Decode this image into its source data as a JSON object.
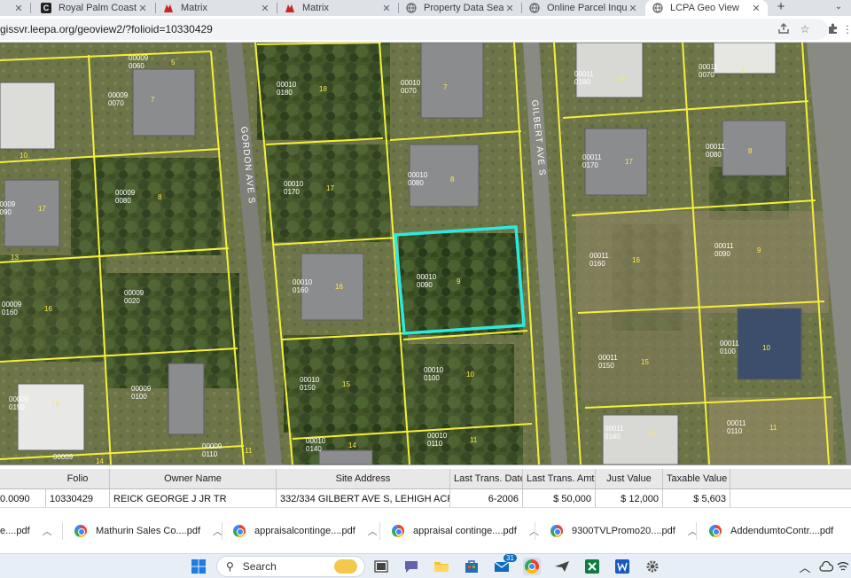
{
  "browser": {
    "tabs": [
      {
        "title": "",
        "icon": "partial-tab-icon"
      },
      {
        "title": "Royal Palm Coast REA",
        "icon": "c-logo-icon",
        "favicon_glyph": "C"
      },
      {
        "title": "Matrix",
        "icon": "matrix-logo-icon"
      },
      {
        "title": "Matrix",
        "icon": "matrix-logo-icon"
      },
      {
        "title": "Property Data Search",
        "icon": "globe-icon"
      },
      {
        "title": "Online Parcel Inquiry",
        "icon": "globe-icon"
      },
      {
        "title": "LCPA Geo View",
        "icon": "globe-icon",
        "active": true
      }
    ],
    "new_tab": "+",
    "url": "gissvr.leepa.org/geoview2/?folioid=10330429"
  },
  "map": {
    "streets": [
      "GORDON AVE S",
      "GILBERT AVE S"
    ],
    "selected_parcel": {
      "id1": "00010",
      "id2": "0090",
      "lot": "9"
    },
    "parcels": [
      {
        "a": "00009",
        "b": "0060",
        "lot": "5"
      },
      {
        "a": "00009",
        "b": "0070",
        "lot": "7"
      },
      {
        "a": "00009",
        "b": "0080",
        "lot": "8"
      },
      {
        "a": "00009",
        "b": "0090",
        "lot": "17"
      },
      {
        "a": "00009",
        "b": "0020",
        "lot": ""
      },
      {
        "a": "00009",
        "b": "0160",
        "lot": "16"
      },
      {
        "a": "00009",
        "b": "0100",
        "lot": ""
      },
      {
        "a": "00009",
        "b": "0150",
        "lot": "15"
      },
      {
        "a": "00009",
        "b": "0110",
        "lot": "11"
      },
      {
        "a": "00009",
        "b": "",
        "lot": "14"
      },
      {
        "a": "00010",
        "b": "0180",
        "lot": "18"
      },
      {
        "a": "00010",
        "b": "0070",
        "lot": "7"
      },
      {
        "a": "00010",
        "b": "0170",
        "lot": "17"
      },
      {
        "a": "00010",
        "b": "0080",
        "lot": "8"
      },
      {
        "a": "00010",
        "b": "0160",
        "lot": "16"
      },
      {
        "a": "00010",
        "b": "0150",
        "lot": "15"
      },
      {
        "a": "00010",
        "b": "0100",
        "lot": "10"
      },
      {
        "a": "00010",
        "b": "0140",
        "lot": "14"
      },
      {
        "a": "00010",
        "b": "0110",
        "lot": "11"
      },
      {
        "a": "00011",
        "b": "0180",
        "lot": "18"
      },
      {
        "a": "00011",
        "b": "0070",
        "lot": "7"
      },
      {
        "a": "00011",
        "b": "0170",
        "lot": "17"
      },
      {
        "a": "00011",
        "b": "0080",
        "lot": "8"
      },
      {
        "a": "00011",
        "b": "0160",
        "lot": "16"
      },
      {
        "a": "00011",
        "b": "0090",
        "lot": "9"
      },
      {
        "a": "00011",
        "b": "0150",
        "lot": "15"
      },
      {
        "a": "00011",
        "b": "0100",
        "lot": "10"
      },
      {
        "a": "00011",
        "b": "0140",
        "lot": "14"
      },
      {
        "a": "00011",
        "b": "0110",
        "lot": "11"
      }
    ],
    "lot_markers": [
      "10",
      "13"
    ]
  },
  "results": {
    "headers": [
      "Folio",
      "Owner Name",
      "Site Address",
      "Last Trans. Date",
      "Last Trans. Amt",
      "Just Value",
      "Taxable Value"
    ],
    "row": {
      "strap": "0.0090",
      "folio": "10330429",
      "owner": "REICK GEORGE J JR TR",
      "address": "332/334 GILBERT AVE S, LEHIGH ACRES",
      "trans_date": "6-2006",
      "trans_amt": "$ 50,000",
      "just_value": "$ 12,000",
      "taxable_value": "$ 5,603"
    }
  },
  "downloads": [
    {
      "name": "e....pdf"
    },
    {
      "name": "Mathurin Sales Co....pdf"
    },
    {
      "name": "appraisalcontinge....pdf"
    },
    {
      "name": "appraisal continge....pdf"
    },
    {
      "name": "9300TVLPromo20....pdf"
    },
    {
      "name": "AddendumtoContr....pdf"
    }
  ],
  "taskbar": {
    "search_label": "Search",
    "badge_count": "31"
  },
  "colors": {
    "parcel_line": "#f5ef3a",
    "selected_outline": "#2ee8e0",
    "tab_strip": "#dee1e6"
  }
}
